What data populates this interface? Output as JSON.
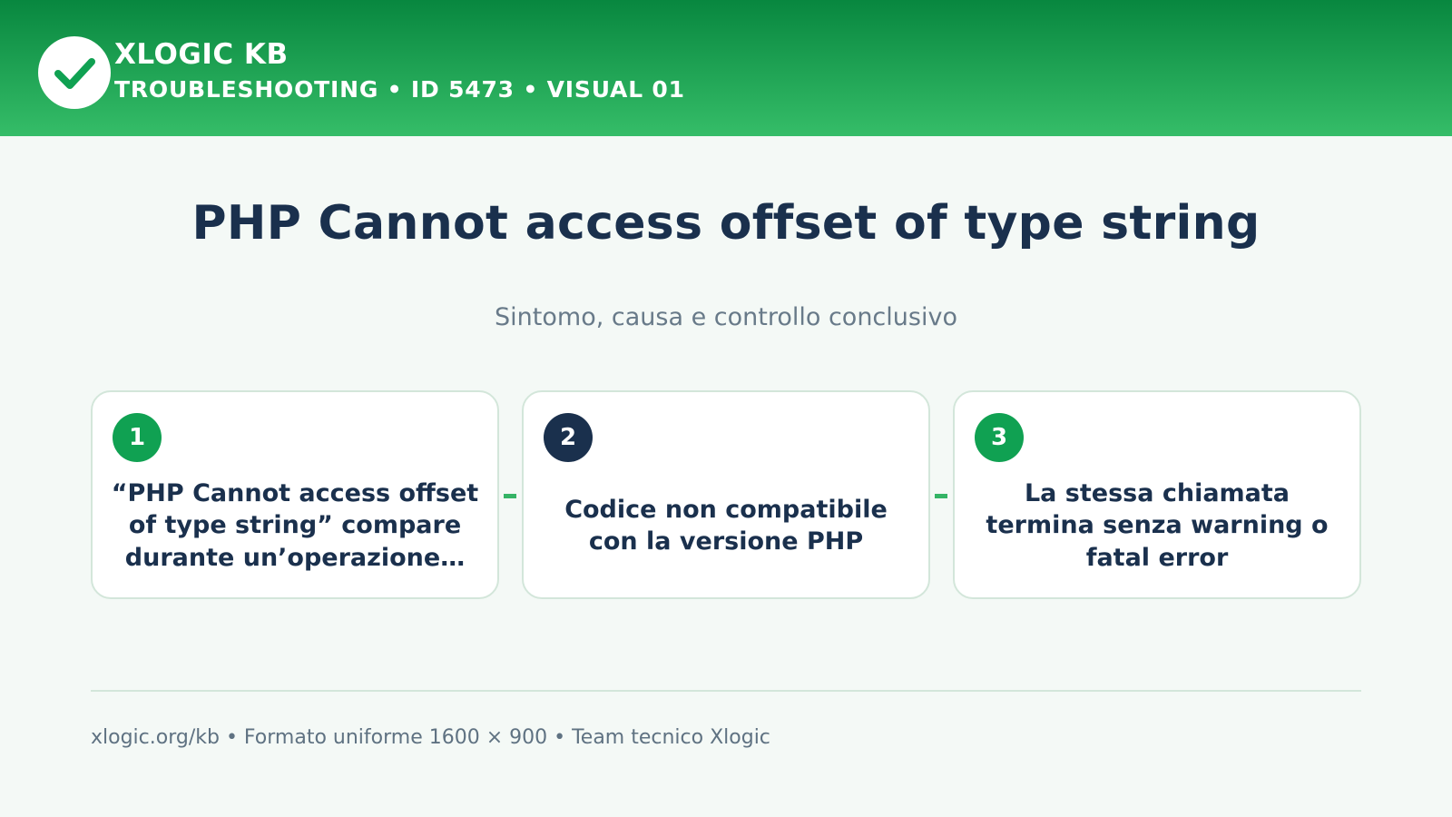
{
  "header": {
    "brand_name": "XLOGIC KB",
    "brand_sub": "TROUBLESHOOTING • ID 5473 • VISUAL 01",
    "logo_icon": "checkmark-icon",
    "gradient_top": "#08873f",
    "gradient_bottom": "#35bd68"
  },
  "main": {
    "title": "PHP Cannot access offset of type string",
    "subtitle": "Sintomo, causa e controllo conclusivo"
  },
  "steps": [
    {
      "number": "1",
      "text": "“PHP Cannot access offset of type string” compare durante un’operazione…",
      "badge_color": "#10a152"
    },
    {
      "number": "2",
      "text": "Codice non compatibile con la versione PHP",
      "badge_color": "#1a304d"
    },
    {
      "number": "3",
      "text": "La stessa chiamata termina senza warning o fatal error",
      "badge_color": "#10a152"
    }
  ],
  "footer": {
    "text": "xlogic.org/kb • Formato uniforme 1600 × 900 • Team tecnico Xlogic"
  }
}
